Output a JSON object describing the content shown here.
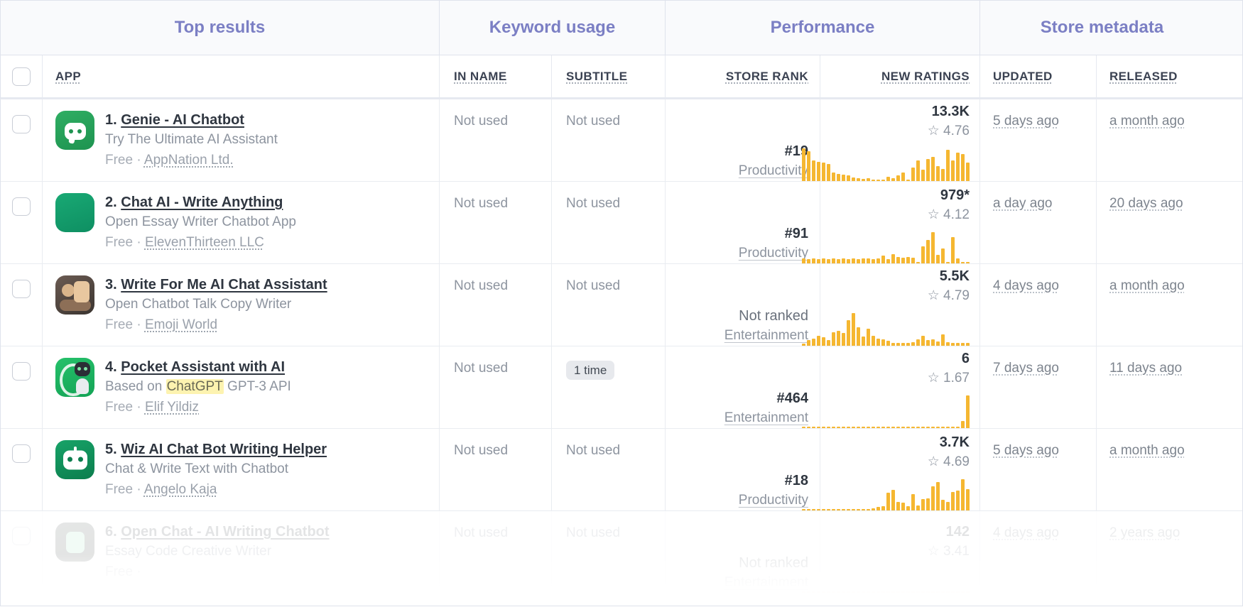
{
  "group_headers": [
    {
      "label": "Top results",
      "name": "group-top-results"
    },
    {
      "label": "Keyword usage",
      "name": "group-keyword-usage"
    },
    {
      "label": "Performance",
      "name": "group-performance"
    },
    {
      "label": "Store metadata",
      "name": "group-store-metadata"
    }
  ],
  "columns": [
    {
      "label": "APP"
    },
    {
      "label": "IN NAME"
    },
    {
      "label": "SUBTITLE"
    },
    {
      "label": "STORE RANK"
    },
    {
      "label": "NEW RATINGS"
    },
    {
      "label": "UPDATED"
    },
    {
      "label": "RELEASED"
    }
  ],
  "colors": {
    "group_header_text": "#7b7fc4",
    "group_header_bg": "#f9fafc",
    "sparkline_bar": "#f5b731",
    "highlight": "#fdf3b0",
    "muted_text": "#8d949f",
    "primary_text": "#2f3640",
    "border": "#e9ecf1"
  },
  "rows": [
    {
      "rank_num": "1.",
      "app_name": "Genie - AI Chatbot",
      "subtitle": "Try The Ultimate AI Assistant",
      "price": "Free",
      "separator": "·",
      "developer": "AppNation Ltd.",
      "icon": "chat-bubble-bot-icon",
      "icon_class": "ic-bot",
      "in_name": "Not used",
      "in_name_badge": null,
      "subtitle_usage": "Not used",
      "subtitle_badge": null,
      "store_rank": "#19",
      "store_category": "Productivity",
      "category_is_link": true,
      "new_ratings": "13.3K",
      "rating_star": "☆",
      "rating_value": "4.76",
      "updated": "5 days ago",
      "released": "a month ago",
      "sparkline": [
        100,
        92,
        64,
        58,
        56,
        52,
        27,
        22,
        20,
        17,
        11,
        9,
        6,
        8,
        3,
        0,
        0,
        14,
        9,
        17,
        26,
        0,
        42,
        62,
        34,
        68,
        74,
        46,
        38,
        95,
        62,
        88,
        82,
        57
      ]
    },
    {
      "rank_num": "2.",
      "app_name": "Chat AI - Write Anything",
      "subtitle": "Open Essay Writer Chatbot App",
      "price": "Free",
      "separator": "·",
      "developer": "ElevenThirteen LLC",
      "icon": "chat-bubble-bot-icon",
      "icon_class": "ic-teal",
      "in_name": "Not used",
      "in_name_badge": null,
      "subtitle_usage": "Not used",
      "subtitle_badge": null,
      "store_rank": "#91",
      "store_category": "Productivity",
      "category_is_link": true,
      "new_ratings": "979*",
      "rating_star": "☆",
      "rating_value": "4.12",
      "updated": "a day ago",
      "released": "20 days ago",
      "sparkline": [
        15,
        14,
        15,
        14,
        15,
        14,
        15,
        14,
        15,
        14,
        15,
        14,
        15,
        15,
        14,
        15,
        24,
        14,
        28,
        19,
        18,
        19,
        18,
        5,
        52,
        72,
        95,
        26,
        45,
        0,
        80,
        16,
        0,
        0
      ]
    },
    {
      "rank_num": "3.",
      "app_name": "Write For Me AI Chat Assistant",
      "subtitle": "Open Chatbot Talk Copy Writer",
      "price": "Free",
      "separator": "·",
      "developer": "Emoji World",
      "icon": "emoji-avatar-icon",
      "icon_class": "ic-dark",
      "in_name": "Not used",
      "in_name_badge": null,
      "subtitle_usage": "Not used",
      "subtitle_badge": null,
      "store_rank": "Not ranked",
      "store_category": "Entertainment",
      "category_is_link": true,
      "new_ratings": "5.5K",
      "rating_star": "☆",
      "rating_value": "4.79",
      "updated": "4 days ago",
      "released": "a month ago",
      "sparkline": [
        6,
        18,
        22,
        30,
        26,
        18,
        42,
        46,
        40,
        78,
        100,
        56,
        28,
        52,
        30,
        22,
        20,
        16,
        9,
        9,
        9,
        9,
        10,
        20,
        30,
        18,
        20,
        12,
        34,
        10,
        8,
        9,
        8,
        8
      ]
    },
    {
      "rank_num": "4.",
      "app_name": "Pocket Assistant with AI",
      "subtitle_pre": "Based on ",
      "subtitle_highlight": "ChatGPT",
      "subtitle_post": " GPT-3 API",
      "subtitle": "Based on ChatGPT GPT-3 API",
      "price": "Free",
      "separator": "·",
      "developer": "Elif Yildiz",
      "icon": "openai-robot-icon",
      "icon_class": "ic-green2",
      "in_name": "Not used",
      "in_name_badge": null,
      "subtitle_usage": null,
      "subtitle_badge": "1 time",
      "store_rank": "#464",
      "store_category": "Entertainment",
      "category_is_link": true,
      "new_ratings": "6",
      "rating_star": "☆",
      "rating_value": "1.67",
      "updated": "7 days ago",
      "released": "11 days ago",
      "sparkline": [
        2,
        2,
        2,
        2,
        2,
        2,
        2,
        2,
        2,
        2,
        2,
        2,
        2,
        2,
        2,
        2,
        2,
        2,
        2,
        2,
        2,
        2,
        2,
        2,
        2,
        2,
        2,
        2,
        2,
        2,
        2,
        2,
        22,
        100
      ]
    },
    {
      "rank_num": "5.",
      "app_name": "Wiz AI Chat Bot Writing Helper",
      "subtitle": "Chat & Write Text with Chatbot",
      "price": "Free",
      "separator": "·",
      "developer": "Angelo Kaja",
      "icon": "chat-bubble-bot-icon",
      "icon_class": "ic-dkgreen",
      "in_name": "Not used",
      "in_name_badge": null,
      "subtitle_usage": "Not used",
      "subtitle_badge": null,
      "store_rank": "#18",
      "store_category": "Productivity",
      "category_is_link": true,
      "new_ratings": "3.7K",
      "rating_star": "☆",
      "rating_value": "4.69",
      "updated": "5 days ago",
      "released": "a month ago",
      "sparkline": [
        4,
        4,
        4,
        4,
        4,
        4,
        4,
        4,
        4,
        4,
        4,
        4,
        4,
        4,
        6,
        10,
        12,
        54,
        62,
        26,
        24,
        12,
        50,
        16,
        34,
        38,
        74,
        88,
        32,
        26,
        56,
        60,
        96,
        66
      ]
    },
    {
      "rank_num": "6.",
      "app_name": "Open Chat - AI Writing Chatbot",
      "subtitle": "Essay Code Creative Writer",
      "price": "Free",
      "separator": "·",
      "developer": "",
      "icon": "chat-bubble-bot-icon",
      "icon_class": "ic-grey",
      "in_name": "Not used",
      "in_name_badge": null,
      "subtitle_usage": "Not used",
      "subtitle_badge": null,
      "store_rank": "Not ranked",
      "store_category": "Entertainment",
      "category_is_link": true,
      "new_ratings": "142",
      "rating_star": "☆",
      "rating_value": "3.41",
      "updated": "4 days ago",
      "released": "2 years ago",
      "sparkline": [
        4,
        4,
        4,
        4,
        4,
        4,
        4,
        4,
        4,
        4,
        4,
        4,
        4,
        4,
        4,
        4,
        4,
        4,
        4,
        4,
        4,
        4,
        4,
        4,
        4,
        4,
        4,
        4,
        4,
        4,
        4,
        4,
        4,
        4
      ]
    }
  ]
}
